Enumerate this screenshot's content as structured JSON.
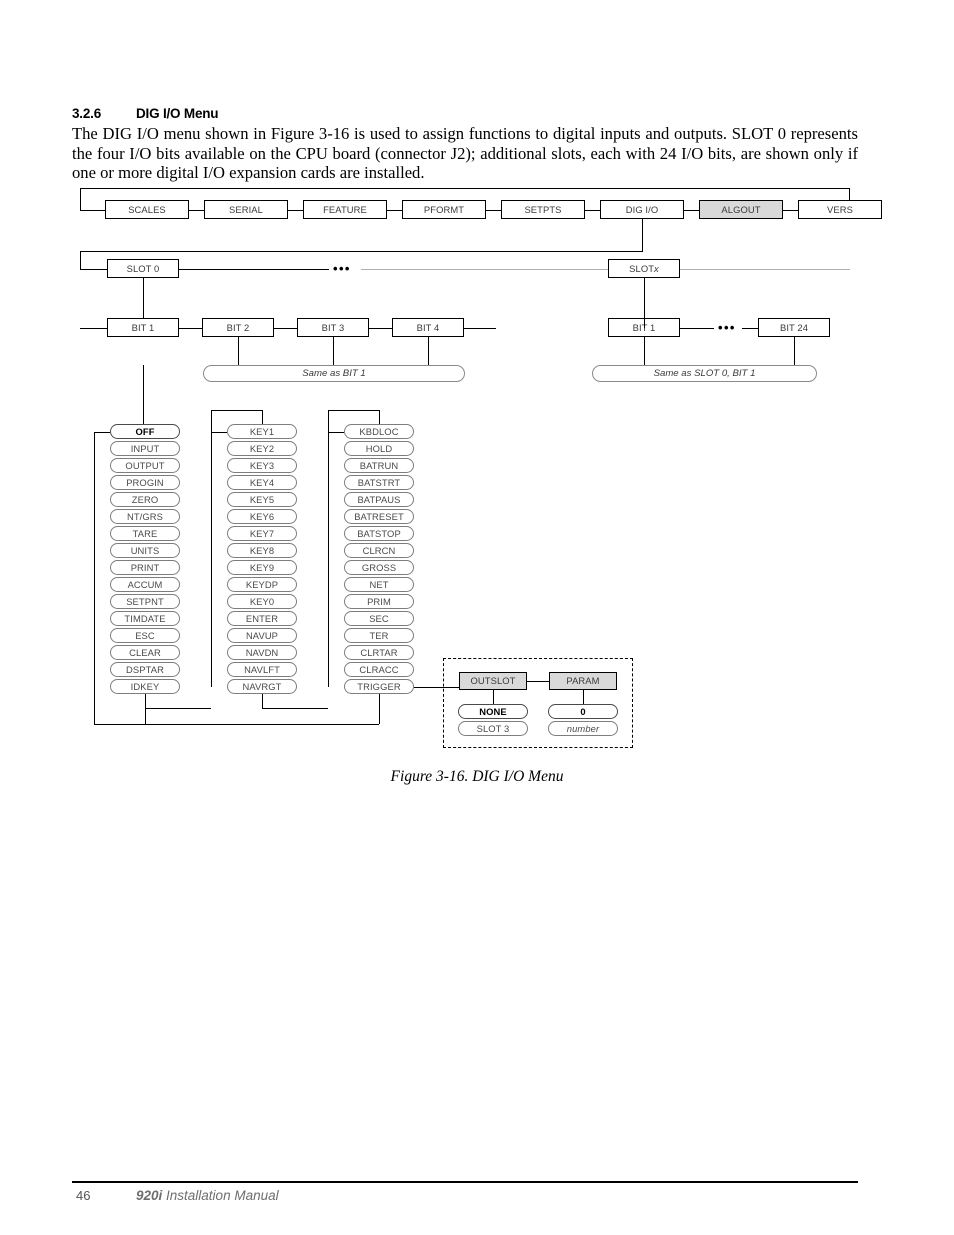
{
  "section": {
    "number": "3.2.6",
    "title": "DIG I/O Menu",
    "body": "The DIG I/O menu shown in Figure 3-16 is used to assign functions to digital inputs and outputs. SLOT 0 represents the four I/O bits available on the CPU board (connector J2); additional slots, each with 24 I/O bits, are shown only if one or more digital I/O expansion cards are installed."
  },
  "figure": {
    "caption": "Figure 3-16. DIG I/O Menu",
    "top_menu": {
      "items": [
        {
          "label": "SCALES",
          "highlighted": false
        },
        {
          "label": "SERIAL",
          "highlighted": false
        },
        {
          "label": "FEATURE",
          "highlighted": false
        },
        {
          "label": "PFORMT",
          "highlighted": false
        },
        {
          "label": "SETPTS",
          "highlighted": false
        },
        {
          "label": "DIG I/O",
          "highlighted": false
        },
        {
          "label": "ALGOUT",
          "highlighted": true
        },
        {
          "label": "VERS",
          "highlighted": false
        }
      ],
      "highlight_color": "#d9d9d9"
    },
    "slot_row": {
      "slot_first": "SLOT 0",
      "slot_last_prefix": "SLOT ",
      "slot_last_italic": "x",
      "ellipsis": "•••"
    },
    "bit_row_left": {
      "bits": [
        "BIT 1",
        "BIT 2",
        "BIT 3",
        "BIT 4"
      ],
      "same_as_note": "Same as BIT 1"
    },
    "bit_row_right": {
      "bits": [
        "BIT 1",
        "BIT 24"
      ],
      "ellipsis": "•••",
      "same_as_note": "Same as SLOT 0, BIT 1"
    },
    "option_columns": [
      {
        "name": "column-1",
        "options": [
          {
            "label": "OFF",
            "default": true
          },
          {
            "label": "INPUT",
            "default": false
          },
          {
            "label": "OUTPUT",
            "default": false
          },
          {
            "label": "PROGIN",
            "default": false
          },
          {
            "label": "ZERO",
            "default": false
          },
          {
            "label": "NT/GRS",
            "default": false
          },
          {
            "label": "TARE",
            "default": false
          },
          {
            "label": "UNITS",
            "default": false
          },
          {
            "label": "PRINT",
            "default": false
          },
          {
            "label": "ACCUM",
            "default": false
          },
          {
            "label": "SETPNT",
            "default": false
          },
          {
            "label": "TIMDATE",
            "default": false
          },
          {
            "label": "ESC",
            "default": false
          },
          {
            "label": "CLEAR",
            "default": false
          },
          {
            "label": "DSPTAR",
            "default": false
          },
          {
            "label": "IDKEY",
            "default": false
          }
        ]
      },
      {
        "name": "column-2",
        "options": [
          {
            "label": "KEY1",
            "default": false
          },
          {
            "label": "KEY2",
            "default": false
          },
          {
            "label": "KEY3",
            "default": false
          },
          {
            "label": "KEY4",
            "default": false
          },
          {
            "label": "KEY5",
            "default": false
          },
          {
            "label": "KEY6",
            "default": false
          },
          {
            "label": "KEY7",
            "default": false
          },
          {
            "label": "KEY8",
            "default": false
          },
          {
            "label": "KEY9",
            "default": false
          },
          {
            "label": "KEYDP",
            "default": false
          },
          {
            "label": "KEY0",
            "default": false
          },
          {
            "label": "ENTER",
            "default": false
          },
          {
            "label": "NAVUP",
            "default": false
          },
          {
            "label": "NAVDN",
            "default": false
          },
          {
            "label": "NAVLFT",
            "default": false
          },
          {
            "label": "NAVRGT",
            "default": false
          }
        ]
      },
      {
        "name": "column-3",
        "options": [
          {
            "label": "KBDLOC",
            "default": false
          },
          {
            "label": "HOLD",
            "default": false
          },
          {
            "label": "BATRUN",
            "default": false
          },
          {
            "label": "BATSTRT",
            "default": false
          },
          {
            "label": "BATPAUS",
            "default": false
          },
          {
            "label": "BATRESET",
            "default": false
          },
          {
            "label": "BATSTOP",
            "default": false
          },
          {
            "label": "CLRCN",
            "default": false
          },
          {
            "label": "GROSS",
            "default": false
          },
          {
            "label": "NET",
            "default": false
          },
          {
            "label": "PRIM",
            "default": false
          },
          {
            "label": "SEC",
            "default": false
          },
          {
            "label": "TER",
            "default": false
          },
          {
            "label": "CLRTAR",
            "default": false
          },
          {
            "label": "CLRACC",
            "default": false
          },
          {
            "label": "TRIGGER",
            "default": false
          }
        ]
      }
    ],
    "trigger_group": {
      "nodes": [
        {
          "label": "OUTSLOT"
        },
        {
          "label": "PARAM"
        }
      ],
      "outslot_options": [
        {
          "label": "NONE",
          "default": true,
          "italic": false
        },
        {
          "label": "SLOT 3",
          "default": false,
          "italic": false
        }
      ],
      "param_options": [
        {
          "label": "0",
          "default": true,
          "italic": false
        },
        {
          "label": "number",
          "default": false,
          "italic": true
        }
      ]
    }
  },
  "footer": {
    "page_number": "46",
    "manual_brand": "920i",
    "manual_title": " Installation Manual"
  }
}
